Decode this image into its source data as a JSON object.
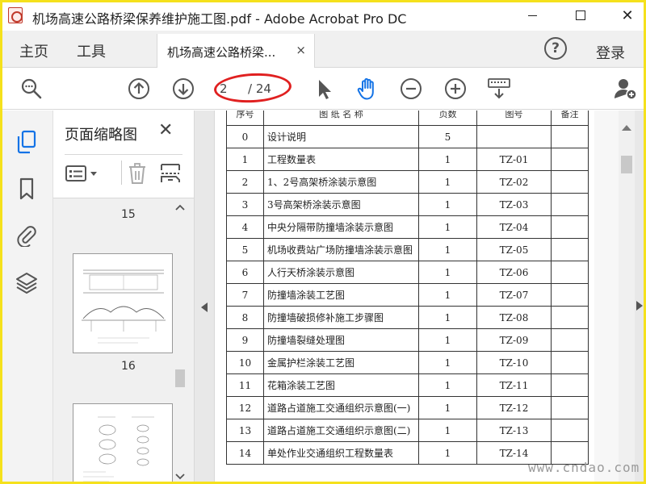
{
  "window": {
    "title": "机场高速公路桥梁保养维护施工图.pdf - Adobe Acrobat Pro DC"
  },
  "menubar": {
    "home": "主页",
    "tools": "工具",
    "doc_tab": "机场高速公路桥梁...",
    "doc_tab_close": "×",
    "help": "?",
    "login": "登录"
  },
  "toolbar": {
    "page_current": "2",
    "page_total": "/ 24"
  },
  "thumb_panel": {
    "title": "页面缩略图",
    "close": "✕",
    "pages": [
      "15",
      "16"
    ]
  },
  "table": {
    "headers": [
      "序号",
      "图 纸 名 称",
      "页数",
      "图号",
      "备注"
    ],
    "rows": [
      {
        "no": "0",
        "name": "设计说明",
        "count": "5",
        "code": ""
      },
      {
        "no": "1",
        "name": "工程数量表",
        "count": "1",
        "code": "TZ-01"
      },
      {
        "no": "2",
        "name": "1、2号高架桥涂装示意图",
        "count": "1",
        "code": "TZ-02"
      },
      {
        "no": "3",
        "name": "3号高架桥涂装示意图",
        "count": "1",
        "code": "TZ-03"
      },
      {
        "no": "4",
        "name": "中央分隔带防撞墙涂装示意图",
        "count": "1",
        "code": "TZ-04"
      },
      {
        "no": "5",
        "name": "机场收费站广场防撞墙涂装示意图",
        "count": "1",
        "code": "TZ-05"
      },
      {
        "no": "6",
        "name": "人行天桥涂装示意图",
        "count": "1",
        "code": "TZ-06"
      },
      {
        "no": "7",
        "name": "防撞墙涂装工艺图",
        "count": "1",
        "code": "TZ-07"
      },
      {
        "no": "8",
        "name": "防撞墙破损修补施工步骤图",
        "count": "1",
        "code": "TZ-08"
      },
      {
        "no": "9",
        "name": "防撞墙裂缝处理图",
        "count": "1",
        "code": "TZ-09"
      },
      {
        "no": "10",
        "name": "金属护栏涂装工艺图",
        "count": "1",
        "code": "TZ-10"
      },
      {
        "no": "11",
        "name": "花箱涂装工艺图",
        "count": "1",
        "code": "TZ-11"
      },
      {
        "no": "12",
        "name": "道路占道施工交通组织示意图(一)",
        "count": "1",
        "code": "TZ-12"
      },
      {
        "no": "13",
        "name": "道路占道施工交通组织示意图(二)",
        "count": "1",
        "code": "TZ-13"
      },
      {
        "no": "14",
        "name": "单处作业交通组织工程数量表",
        "count": "1",
        "code": "TZ-14"
      }
    ]
  },
  "watermark": "www.cndao.com",
  "colors": {
    "accent_blue": "#1473e6",
    "annotation_red": "#e02020",
    "frame_yellow": "#f5e11c"
  },
  "icons": {
    "zoom": "magnifier-icon",
    "prev": "arrow-up-circle-icon",
    "next": "arrow-down-circle-icon",
    "select": "cursor-arrow-icon",
    "hand": "hand-icon",
    "zoom_out": "minus-circle-icon",
    "zoom_in": "plus-circle-icon",
    "keyboard": "keyboard-icon",
    "share": "add-user-icon"
  }
}
